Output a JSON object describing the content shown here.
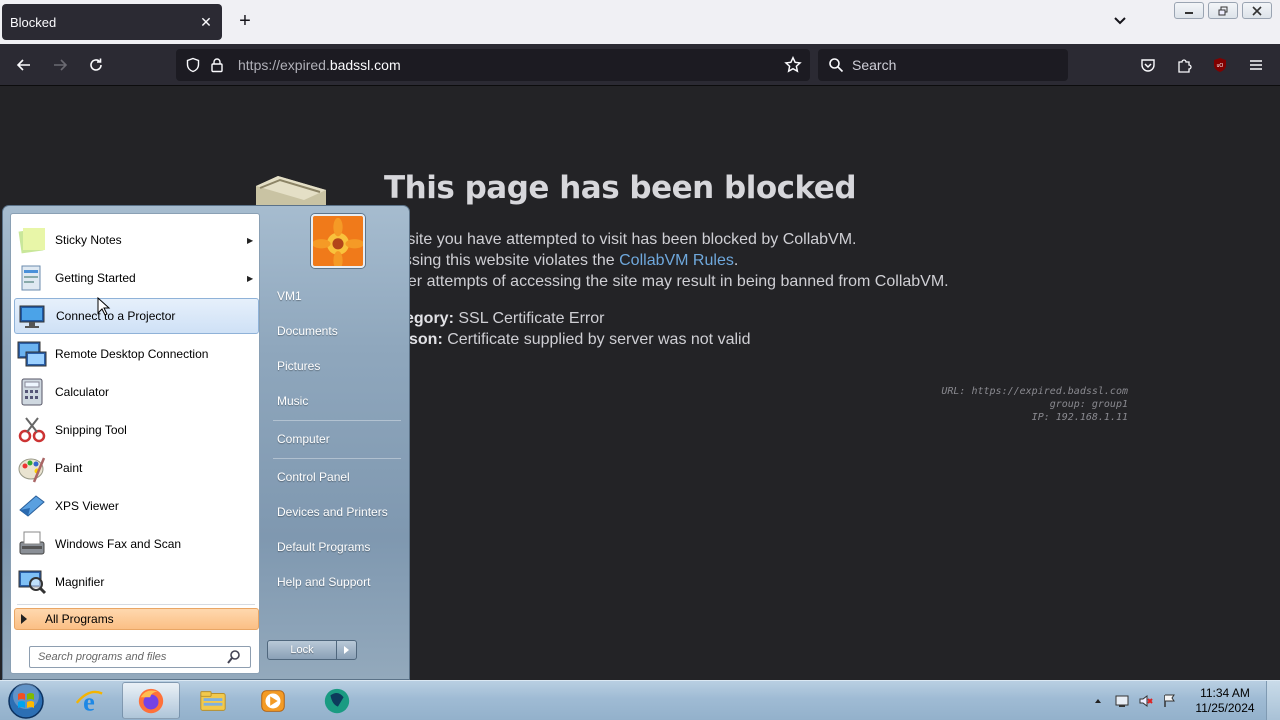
{
  "browser": {
    "tab_title": "Blocked",
    "tab_close": "✕",
    "new_tab": "+",
    "url_prefix": "https://expired.",
    "url_domain": "badssl.com",
    "search_placeholder": "Search"
  },
  "page": {
    "title": "This page has been blocked",
    "line1": " website you have attempted to visit has been blocked by CollabVM.",
    "line2_pre": "essing this website violates the ",
    "line2_link": "CollabVM Rules",
    "line2_post": ".",
    "line3": "her attempts of accessing the site may result in being banned from CollabVM.",
    "category_label": "egory:",
    "category_value": " SSL Certificate Error",
    "reason_label": "son:",
    "reason_value": " Certificate supplied by server was not valid",
    "meta_url": "URL: https://expired.badssl.com",
    "meta_group": "group: group1",
    "meta_ip": "IP: 192.168.1.11"
  },
  "startmenu": {
    "items": [
      {
        "label": "Sticky Notes",
        "icon": "sticky-notes-icon",
        "submenu": true
      },
      {
        "label": "Getting Started",
        "icon": "getting-started-icon",
        "submenu": true
      },
      {
        "label": "Connect to a Projector",
        "icon": "projector-icon",
        "submenu": false
      },
      {
        "label": "Remote Desktop Connection",
        "icon": "remote-desktop-icon",
        "submenu": false
      },
      {
        "label": "Calculator",
        "icon": "calculator-icon",
        "submenu": false
      },
      {
        "label": "Snipping Tool",
        "icon": "snipping-tool-icon",
        "submenu": false
      },
      {
        "label": "Paint",
        "icon": "paint-icon",
        "submenu": false
      },
      {
        "label": "XPS Viewer",
        "icon": "xps-viewer-icon",
        "submenu": false
      },
      {
        "label": "Windows Fax and Scan",
        "icon": "fax-scan-icon",
        "submenu": false
      },
      {
        "label": "Magnifier",
        "icon": "magnifier-icon",
        "submenu": false
      }
    ],
    "all_programs": "All Programs",
    "search_placeholder": "Search programs and files",
    "right_items": [
      "VM1",
      "Documents",
      "Pictures",
      "Music",
      "Computer",
      "Control Panel",
      "Devices and Printers",
      "Default Programs",
      "Help and Support"
    ],
    "lock_label": "Lock"
  },
  "taskbar": {
    "time": "11:34 AM",
    "date": "11/25/2024",
    "apps": [
      "internet-explorer-icon",
      "firefox-icon",
      "file-explorer-icon",
      "media-player-icon",
      "collabvm-icon"
    ]
  },
  "colors": {
    "page_bg": "#232326",
    "link": "#6fa8dc",
    "highlight_orange": "#fbbf85"
  }
}
